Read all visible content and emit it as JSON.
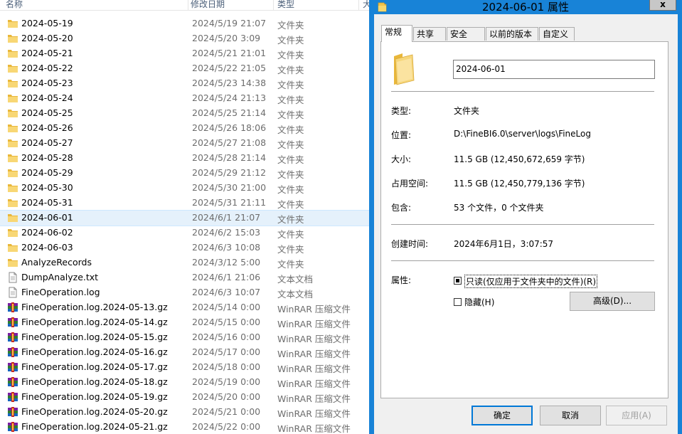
{
  "explorer": {
    "columns": {
      "name": "名称",
      "date": "修改日期",
      "type": "类型",
      "size": "大"
    },
    "rows": [
      {
        "name": "2024-05-19",
        "date": "2024/5/19 21:07",
        "type": "文件夹",
        "icon": "folder-icon"
      },
      {
        "name": "2024-05-20",
        "date": "2024/5/20 3:09",
        "type": "文件夹",
        "icon": "folder-icon"
      },
      {
        "name": "2024-05-21",
        "date": "2024/5/21 21:01",
        "type": "文件夹",
        "icon": "folder-icon"
      },
      {
        "name": "2024-05-22",
        "date": "2024/5/22 21:05",
        "type": "文件夹",
        "icon": "folder-icon"
      },
      {
        "name": "2024-05-23",
        "date": "2024/5/23 14:38",
        "type": "文件夹",
        "icon": "folder-icon"
      },
      {
        "name": "2024-05-24",
        "date": "2024/5/24 21:13",
        "type": "文件夹",
        "icon": "folder-icon"
      },
      {
        "name": "2024-05-25",
        "date": "2024/5/25 21:14",
        "type": "文件夹",
        "icon": "folder-icon"
      },
      {
        "name": "2024-05-26",
        "date": "2024/5/26 18:06",
        "type": "文件夹",
        "icon": "folder-icon"
      },
      {
        "name": "2024-05-27",
        "date": "2024/5/27 21:08",
        "type": "文件夹",
        "icon": "folder-icon"
      },
      {
        "name": "2024-05-28",
        "date": "2024/5/28 21:14",
        "type": "文件夹",
        "icon": "folder-icon"
      },
      {
        "name": "2024-05-29",
        "date": "2024/5/29 21:12",
        "type": "文件夹",
        "icon": "folder-icon"
      },
      {
        "name": "2024-05-30",
        "date": "2024/5/30 21:00",
        "type": "文件夹",
        "icon": "folder-icon"
      },
      {
        "name": "2024-05-31",
        "date": "2024/5/31 21:11",
        "type": "文件夹",
        "icon": "folder-icon"
      },
      {
        "name": "2024-06-01",
        "date": "2024/6/1 21:07",
        "type": "文件夹",
        "icon": "folder-icon",
        "selected": true
      },
      {
        "name": "2024-06-02",
        "date": "2024/6/2 15:03",
        "type": "文件夹",
        "icon": "folder-icon"
      },
      {
        "name": "2024-06-03",
        "date": "2024/6/3 10:08",
        "type": "文件夹",
        "icon": "folder-icon"
      },
      {
        "name": "AnalyzeRecords",
        "date": "2024/3/12 5:00",
        "type": "文件夹",
        "icon": "folder-icon"
      },
      {
        "name": "DumpAnalyze.txt",
        "date": "2024/6/1 21:06",
        "type": "文本文档",
        "icon": "text-file-icon"
      },
      {
        "name": "FineOperation.log",
        "date": "2024/6/3 10:07",
        "type": "文本文档",
        "icon": "text-file-icon"
      },
      {
        "name": "FineOperation.log.2024-05-13.gz",
        "date": "2024/5/14 0:00",
        "type": "WinRAR 压缩文件",
        "icon": "winrar-archive-icon"
      },
      {
        "name": "FineOperation.log.2024-05-14.gz",
        "date": "2024/5/15 0:00",
        "type": "WinRAR 压缩文件",
        "icon": "winrar-archive-icon"
      },
      {
        "name": "FineOperation.log.2024-05-15.gz",
        "date": "2024/5/16 0:00",
        "type": "WinRAR 压缩文件",
        "icon": "winrar-archive-icon"
      },
      {
        "name": "FineOperation.log.2024-05-16.gz",
        "date": "2024/5/17 0:00",
        "type": "WinRAR 压缩文件",
        "icon": "winrar-archive-icon"
      },
      {
        "name": "FineOperation.log.2024-05-17.gz",
        "date": "2024/5/18 0:00",
        "type": "WinRAR 压缩文件",
        "icon": "winrar-archive-icon"
      },
      {
        "name": "FineOperation.log.2024-05-18.gz",
        "date": "2024/5/19 0:00",
        "type": "WinRAR 压缩文件",
        "icon": "winrar-archive-icon"
      },
      {
        "name": "FineOperation.log.2024-05-19.gz",
        "date": "2024/5/20 0:00",
        "type": "WinRAR 压缩文件",
        "icon": "winrar-archive-icon"
      },
      {
        "name": "FineOperation.log.2024-05-20.gz",
        "date": "2024/5/21 0:00",
        "type": "WinRAR 压缩文件",
        "icon": "winrar-archive-icon"
      },
      {
        "name": "FineOperation.log.2024-05-21.gz",
        "date": "2024/5/22 0:00",
        "type": "WinRAR 压缩文件",
        "icon": "winrar-archive-icon"
      }
    ]
  },
  "dialog": {
    "title": "2024-06-01 属性",
    "close_label": "x",
    "tabs": [
      "常规",
      "共享",
      "安全",
      "以前的版本",
      "自定义"
    ],
    "name_value": "2024-06-01",
    "fields": {
      "type_label": "类型:",
      "type_value": "文件夹",
      "location_label": "位置:",
      "location_value": "D:\\FineBI6.0\\server\\logs\\FineLog",
      "size_label": "大小:",
      "size_value": "11.5 GB (12,450,672,659 字节)",
      "size_on_disk_label": "占用空间:",
      "size_on_disk_value": "11.5 GB (12,450,779,136 字节)",
      "contains_label": "包含:",
      "contains_value": "53 个文件，0 个文件夹",
      "created_label": "创建时间:",
      "created_value": "2024年6月1日，3:07:57",
      "attributes_label": "属性:"
    },
    "readonly_label": "只读(仅应用于文件夹中的文件)(R)",
    "readonly_state": "indeterminate",
    "hidden_label": "隐藏(H)",
    "hidden_state": "unchecked",
    "advanced_label": "高级(D)...",
    "ok_label": "确定",
    "cancel_label": "取消",
    "apply_label": "应用(A)"
  }
}
